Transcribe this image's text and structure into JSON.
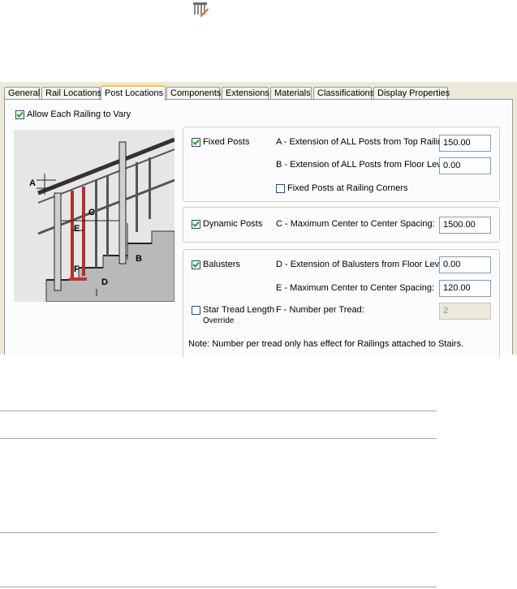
{
  "tabs": [
    {
      "label": "General",
      "active": false
    },
    {
      "label": "Rail Locations",
      "active": false
    },
    {
      "label": "Post Locations",
      "active": true
    },
    {
      "label": "Components",
      "active": false
    },
    {
      "label": "Extensions",
      "active": false
    },
    {
      "label": "Materials",
      "active": false
    },
    {
      "label": "Classifications",
      "active": false
    },
    {
      "label": "Display Properties",
      "active": false
    }
  ],
  "allow_vary": {
    "label": "Allow Each Railing to Vary",
    "checked": true
  },
  "fixed_posts": {
    "label": "Fixed Posts",
    "checked": true,
    "a_label": "A - Extension of ALL Posts from Top Railing:",
    "a_value": "150.00",
    "b_label": "B - Extension of ALL Posts from Floor Level:",
    "b_value": "0.00",
    "corners_label": "Fixed Posts at Railing Corners",
    "corners_checked": false
  },
  "dynamic_posts": {
    "label": "Dynamic Posts",
    "checked": true,
    "c_label": "C - Maximum Center to Center Spacing:",
    "c_value": "1500.00"
  },
  "balusters": {
    "label": "Balusters",
    "checked": true,
    "d_label": "D - Extension of Balusters from Floor Level:",
    "d_value": "0.00",
    "e_label": "E - Maximum Center to Center Spacing:",
    "e_value": "120.00"
  },
  "stair_tread": {
    "label_line1": "Star Tread Length",
    "label_line2": "Override",
    "checked": false,
    "f_label": "F - Number per Tread:",
    "f_value": "2"
  },
  "note": "Note: Number per tread only has effect for Railings attached to Stairs.",
  "diagram_letters": [
    "A",
    "B",
    "C",
    "D",
    "E",
    "F"
  ],
  "colors": {
    "accent_tab": "#ffc83c",
    "baluster_red": "#c83232",
    "check_green": "#21a121"
  }
}
